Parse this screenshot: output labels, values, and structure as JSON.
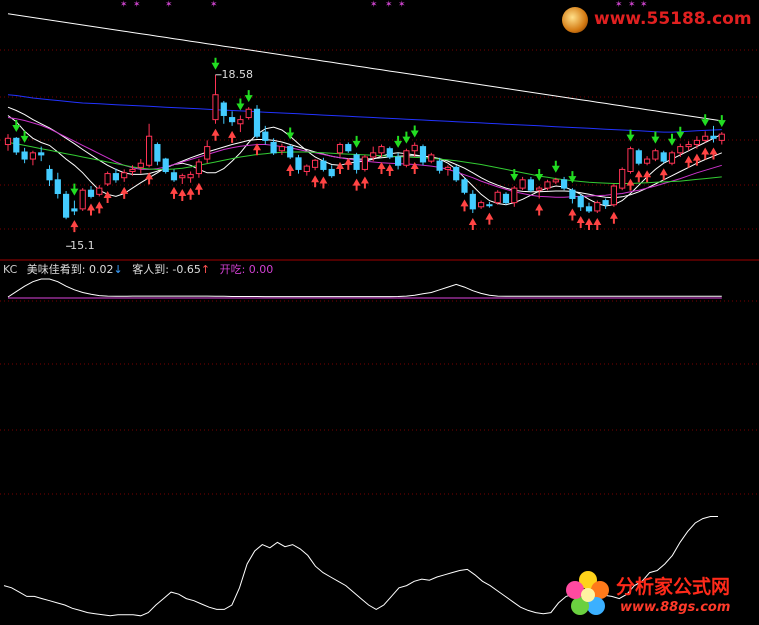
{
  "chart_data": {
    "type": "candlestick",
    "title": "",
    "candles": [
      [
        16.9,
        17.15,
        16.75,
        17.05
      ],
      [
        17.05,
        17.08,
        16.65,
        16.72
      ],
      [
        16.72,
        16.82,
        16.45,
        16.55
      ],
      [
        16.55,
        16.75,
        16.4,
        16.7
      ],
      [
        16.7,
        16.85,
        16.5,
        16.65
      ],
      [
        16.3,
        16.4,
        15.9,
        16.05
      ],
      [
        16.05,
        16.22,
        15.6,
        15.72
      ],
      [
        15.7,
        15.78,
        15.1,
        15.15
      ],
      [
        15.35,
        15.55,
        15.2,
        15.3
      ],
      [
        15.35,
        15.85,
        15.3,
        15.8
      ],
      [
        15.8,
        15.9,
        15.6,
        15.65
      ],
      [
        15.7,
        15.92,
        15.65,
        15.85
      ],
      [
        15.95,
        16.25,
        15.9,
        16.2
      ],
      [
        16.2,
        16.32,
        15.98,
        16.05
      ],
      [
        16.1,
        16.3,
        16.0,
        16.22
      ],
      [
        16.25,
        16.4,
        16.15,
        16.3
      ],
      [
        16.35,
        16.55,
        16.2,
        16.45
      ],
      [
        16.4,
        17.4,
        16.35,
        17.1
      ],
      [
        16.9,
        16.95,
        16.4,
        16.5
      ],
      [
        16.55,
        16.58,
        16.2,
        16.25
      ],
      [
        16.22,
        16.3,
        16.0,
        16.05
      ],
      [
        16.1,
        16.2,
        15.95,
        16.15
      ],
      [
        16.1,
        16.25,
        15.98,
        16.18
      ],
      [
        16.2,
        16.55,
        16.1,
        16.48
      ],
      [
        16.55,
        17.0,
        16.45,
        16.85
      ],
      [
        17.5,
        18.58,
        17.4,
        18.1
      ],
      [
        17.9,
        17.95,
        17.4,
        17.6
      ],
      [
        17.55,
        17.7,
        17.35,
        17.45
      ],
      [
        17.4,
        17.6,
        17.2,
        17.5
      ],
      [
        17.55,
        17.8,
        17.5,
        17.75
      ],
      [
        17.75,
        17.85,
        17.05,
        17.1
      ],
      [
        17.2,
        17.35,
        16.9,
        17.0
      ],
      [
        16.95,
        17.05,
        16.65,
        16.7
      ],
      [
        16.75,
        16.92,
        16.65,
        16.85
      ],
      [
        16.85,
        16.9,
        16.55,
        16.6
      ],
      [
        16.58,
        16.65,
        16.2,
        16.3
      ],
      [
        16.25,
        16.42,
        16.15,
        16.38
      ],
      [
        16.35,
        16.55,
        16.28,
        16.52
      ],
      [
        16.5,
        16.58,
        16.25,
        16.3
      ],
      [
        16.3,
        16.4,
        16.1,
        16.15
      ],
      [
        16.7,
        16.95,
        16.6,
        16.9
      ],
      [
        16.9,
        16.95,
        16.7,
        16.75
      ],
      [
        16.65,
        16.7,
        16.2,
        16.3
      ],
      [
        16.3,
        16.65,
        16.25,
        16.6
      ],
      [
        16.6,
        16.85,
        16.5,
        16.7
      ],
      [
        16.7,
        16.9,
        16.6,
        16.85
      ],
      [
        16.8,
        16.85,
        16.55,
        16.6
      ],
      [
        16.6,
        16.7,
        16.3,
        16.4
      ],
      [
        16.4,
        16.8,
        16.35,
        16.75
      ],
      [
        16.75,
        16.95,
        16.6,
        16.88
      ],
      [
        16.85,
        16.9,
        16.4,
        16.48
      ],
      [
        16.5,
        16.7,
        16.45,
        16.65
      ],
      [
        16.5,
        16.58,
        16.2,
        16.28
      ],
      [
        16.3,
        16.4,
        16.15,
        16.35
      ],
      [
        16.35,
        16.4,
        16.0,
        16.05
      ],
      [
        16.05,
        16.1,
        15.7,
        15.75
      ],
      [
        15.7,
        15.8,
        15.25,
        15.35
      ],
      [
        15.4,
        15.55,
        15.35,
        15.5
      ],
      [
        15.45,
        15.52,
        15.38,
        15.44
      ],
      [
        15.5,
        15.8,
        15.45,
        15.75
      ],
      [
        15.7,
        15.75,
        15.45,
        15.5
      ],
      [
        15.5,
        15.9,
        15.4,
        15.85
      ],
      [
        15.85,
        16.12,
        15.8,
        16.05
      ],
      [
        16.05,
        16.12,
        15.75,
        15.8
      ],
      [
        15.8,
        15.9,
        15.6,
        15.85
      ],
      [
        15.85,
        16.05,
        15.8,
        16.0
      ],
      [
        16.0,
        16.1,
        15.95,
        16.05
      ],
      [
        16.05,
        16.12,
        15.8,
        15.85
      ],
      [
        15.8,
        15.85,
        15.48,
        15.6
      ],
      [
        15.65,
        15.7,
        15.3,
        15.4
      ],
      [
        15.4,
        15.5,
        15.25,
        15.3
      ],
      [
        15.3,
        15.55,
        15.25,
        15.5
      ],
      [
        15.55,
        15.6,
        15.35,
        15.45
      ],
      [
        15.45,
        15.95,
        15.4,
        15.9
      ],
      [
        15.85,
        16.35,
        15.8,
        16.3
      ],
      [
        16.25,
        16.85,
        16.2,
        16.8
      ],
      [
        16.75,
        16.8,
        16.4,
        16.45
      ],
      [
        16.45,
        16.62,
        16.4,
        16.55
      ],
      [
        16.55,
        16.8,
        16.5,
        16.75
      ],
      [
        16.7,
        16.75,
        16.45,
        16.5
      ],
      [
        16.45,
        16.75,
        16.4,
        16.7
      ],
      [
        16.7,
        16.92,
        16.6,
        16.85
      ],
      [
        16.85,
        16.98,
        16.75,
        16.9
      ],
      [
        16.9,
        17.1,
        16.8,
        17.0
      ],
      [
        17.0,
        17.22,
        16.95,
        17.1
      ],
      [
        17.1,
        17.35,
        16.95,
        17.05
      ],
      [
        17.0,
        17.2,
        16.9,
        17.15
      ]
    ],
    "price_labels": {
      "high": "18.58",
      "low": "15.1"
    },
    "ma_series": [
      {
        "values": [
          17.6,
          17.45,
          17.22,
          17.05,
          16.95,
          16.88,
          16.72,
          16.55,
          16.4,
          16.22,
          16.0,
          15.8,
          15.7,
          15.65,
          15.72,
          15.85,
          15.98,
          16.1,
          16.22,
          16.35,
          16.42,
          16.45,
          16.4,
          16.3,
          16.22,
          16.22,
          16.32,
          16.5,
          16.7,
          16.95,
          17.15,
          17.28,
          17.32,
          17.25,
          17.1,
          16.92,
          16.75,
          16.6,
          16.5,
          16.42,
          16.4,
          16.45,
          16.48,
          16.5,
          16.55,
          16.62,
          16.68,
          16.7,
          16.68,
          16.65,
          16.62,
          16.6,
          16.55,
          16.45,
          16.3,
          16.1,
          15.9,
          15.7,
          15.55,
          15.48,
          15.45,
          15.5,
          15.58,
          15.68,
          15.78,
          15.85,
          15.9,
          15.88,
          15.8,
          15.7,
          15.58,
          15.48,
          15.42,
          15.45,
          15.55,
          15.72,
          15.92,
          16.12,
          16.3,
          16.45,
          16.55,
          16.65,
          16.75,
          16.85,
          16.95,
          17.05,
          17.15
        ]
      },
      {
        "values": [
          17.8,
          17.72,
          17.62,
          17.5,
          17.4,
          17.3,
          17.18,
          17.05,
          16.92,
          16.78,
          16.65,
          16.52,
          16.4,
          16.3,
          16.22,
          16.18,
          16.18,
          16.2,
          16.26,
          16.34,
          16.42,
          16.5,
          16.58,
          16.65,
          16.72,
          16.78,
          16.84,
          16.9,
          16.95,
          17.0,
          17.02,
          17.02,
          17.0,
          16.96,
          16.9,
          16.84,
          16.78,
          16.72,
          16.67,
          16.62,
          16.58,
          16.56,
          16.55,
          16.55,
          16.56,
          16.58,
          16.6,
          16.62,
          16.63,
          16.63,
          16.62,
          16.6,
          16.56,
          16.5,
          16.42,
          16.33,
          16.22,
          16.1,
          16.0,
          15.92,
          15.85,
          15.8,
          15.77,
          15.76,
          15.76,
          15.77,
          15.78,
          15.78,
          15.77,
          15.74,
          15.7,
          15.66,
          15.63,
          15.62,
          15.64,
          15.69,
          15.76,
          15.85,
          15.95,
          16.05,
          16.15,
          16.25,
          16.35,
          16.45,
          16.54,
          16.62,
          16.7
        ]
      },
      {
        "values": [
          17.55,
          17.52,
          17.48,
          17.42,
          17.36,
          17.28,
          17.18,
          17.08,
          16.98,
          16.88,
          16.78,
          16.68,
          16.58,
          16.48,
          16.4,
          16.34,
          16.3,
          16.3,
          16.32,
          16.36,
          16.42,
          16.48,
          16.54,
          16.6,
          16.66,
          16.72,
          16.78,
          16.82,
          16.86,
          16.88,
          16.9,
          16.9,
          16.88,
          16.85,
          16.82,
          16.78,
          16.74,
          16.7,
          16.66,
          16.62,
          16.58,
          16.55,
          16.52,
          16.5,
          16.48,
          16.46,
          16.45,
          16.44,
          16.43,
          16.42,
          16.4,
          16.38,
          16.35,
          16.3,
          16.24,
          16.17,
          16.1,
          16.02,
          15.95,
          15.88,
          15.82,
          15.76,
          15.72,
          15.68,
          15.65,
          15.64,
          15.63,
          15.63,
          15.64,
          15.65,
          15.66,
          15.67,
          15.68,
          15.7,
          15.72,
          15.76,
          15.8,
          15.85,
          15.9,
          15.96,
          16.02,
          16.08,
          16.15,
          16.22,
          16.28,
          16.34,
          16.4
        ]
      },
      {
        "values": [
          16.95,
          16.92,
          16.88,
          16.84,
          16.8,
          16.76,
          16.72,
          16.68,
          16.64,
          16.6,
          16.56,
          16.52,
          16.48,
          16.44,
          16.4,
          16.36,
          16.33,
          16.31,
          16.3,
          16.3,
          16.31,
          16.33,
          16.36,
          16.4,
          16.44,
          16.48,
          16.52,
          16.56,
          16.6,
          16.63,
          16.66,
          16.68,
          16.7,
          16.71,
          16.72,
          16.72,
          16.72,
          16.71,
          16.7,
          16.69,
          16.68,
          16.67,
          16.66,
          16.65,
          16.64,
          16.63,
          16.62,
          16.61,
          16.6,
          16.59,
          16.58,
          16.57,
          16.55,
          16.53,
          16.51,
          16.48,
          16.45,
          16.42,
          16.38,
          16.34,
          16.3,
          16.26,
          16.22,
          16.18,
          16.14,
          16.11,
          16.08,
          16.05,
          16.03,
          16.01,
          15.99,
          15.98,
          15.97,
          15.96,
          15.96,
          15.96,
          15.97,
          15.98,
          15.99,
          16.0,
          16.01,
          16.02,
          16.04,
          16.06,
          16.08,
          16.1,
          16.12
        ]
      },
      {
        "values": [
          18.1,
          18.08,
          18.05,
          18.02,
          18.0,
          17.98,
          17.96,
          17.94,
          17.92,
          17.9,
          17.89,
          17.88,
          17.87,
          17.86,
          17.85,
          17.84,
          17.83,
          17.82,
          17.81,
          17.8,
          17.79,
          17.78,
          17.77,
          17.76,
          17.75,
          17.74,
          17.73,
          17.72,
          17.71,
          17.7,
          17.69,
          17.68,
          17.67,
          17.66,
          17.65,
          17.64,
          17.63,
          17.62,
          17.61,
          17.6,
          17.59,
          17.58,
          17.57,
          17.56,
          17.55,
          17.54,
          17.53,
          17.52,
          17.51,
          17.5,
          17.49,
          17.48,
          17.47,
          17.46,
          17.45,
          17.44,
          17.43,
          17.42,
          17.41,
          17.4,
          17.39,
          17.38,
          17.37,
          17.36,
          17.35,
          17.34,
          17.33,
          17.32,
          17.31,
          17.3,
          17.29,
          17.28,
          17.27,
          17.26,
          17.25,
          17.24,
          17.23,
          17.22,
          17.21,
          17.2,
          17.2,
          17.21,
          17.22,
          17.23,
          17.24,
          17.25,
          17.26
        ]
      },
      {
        "values": [
          20.05,
          20.02,
          19.99,
          19.96,
          19.93,
          19.9,
          19.87,
          19.84,
          19.81,
          19.78,
          19.75,
          19.72,
          19.69,
          19.66,
          19.63,
          19.6,
          19.57,
          19.54,
          19.51,
          19.48,
          19.45,
          19.42,
          19.39,
          19.36,
          19.33,
          19.3,
          19.27,
          19.24,
          19.21,
          19.18,
          19.15,
          19.12,
          19.09,
          19.06,
          19.03,
          19.0,
          18.97,
          18.94,
          18.91,
          18.88,
          18.85,
          18.82,
          18.79,
          18.76,
          18.73,
          18.7,
          18.67,
          18.64,
          18.61,
          18.58,
          18.55,
          18.52,
          18.49,
          18.46,
          18.43,
          18.4,
          18.37,
          18.34,
          18.31,
          18.28,
          18.25,
          18.22,
          18.19,
          18.16,
          18.13,
          18.1,
          18.07,
          18.04,
          18.01,
          17.98,
          17.95,
          17.92,
          17.89,
          17.86,
          17.83,
          17.8,
          17.77,
          17.74,
          17.71,
          17.68,
          17.65,
          17.62,
          17.59,
          17.56,
          17.53,
          17.5,
          17.47
        ]
      }
    ],
    "down_arrows": [
      1,
      2,
      8,
      25,
      28,
      29,
      34,
      42,
      47,
      48,
      49,
      61,
      64,
      66,
      68,
      75,
      78,
      80,
      81,
      84,
      86
    ],
    "up_arrows": [
      8,
      10,
      11,
      12,
      14,
      17,
      20,
      21,
      22,
      23,
      25,
      27,
      30,
      34,
      37,
      38,
      40,
      41,
      42,
      43,
      45,
      46,
      49,
      55,
      56,
      58,
      64,
      68,
      69,
      70,
      71,
      73,
      75,
      76,
      77,
      79,
      82,
      83,
      84,
      85
    ],
    "indicator_labels": {
      "prefix": "KC",
      "series": [
        {
          "text": "美味佳肴到: 0.02",
          "arrow": "↓"
        },
        {
          "text": "客人到: -0.65",
          "arrow": "↑"
        },
        {
          "text": "开吃: 0.00",
          "arrow": ""
        }
      ]
    },
    "indicator_values": [
      0.0,
      0.3,
      0.6,
      0.85,
      1.0,
      1.0,
      0.85,
      0.6,
      0.4,
      0.25,
      0.15,
      0.08,
      0.05,
      0.04,
      0.04,
      0.05,
      0.05,
      0.05,
      0.05,
      0.05,
      0.05,
      0.05,
      0.05,
      0.05,
      0.05,
      0.04,
      0.04,
      0.03,
      0.03,
      0.03,
      0.03,
      0.02,
      0.02,
      0.02,
      0.02,
      0.02,
      0.02,
      0.02,
      0.02,
      0.02,
      0.02,
      0.02,
      0.02,
      0.02,
      0.02,
      0.02,
      0.02,
      0.03,
      0.05,
      0.1,
      0.18,
      0.25,
      0.4,
      0.55,
      0.7,
      0.55,
      0.35,
      0.2,
      0.1,
      0.05,
      0.04,
      0.04,
      0.04,
      0.04,
      0.04,
      0.04,
      0.04,
      0.04,
      0.04,
      0.04,
      0.04,
      0.04,
      0.04,
      0.04,
      0.04,
      0.04,
      0.04,
      0.04,
      0.04,
      0.04,
      0.04,
      0.04,
      0.04,
      0.04,
      0.04,
      0.04,
      0.04
    ],
    "oscillator_values": [
      0.3,
      0.28,
      0.24,
      0.2,
      0.2,
      0.18,
      0.16,
      0.14,
      0.12,
      0.09,
      0.07,
      0.05,
      0.04,
      0.03,
      0.02,
      0.03,
      0.03,
      0.03,
      0.02,
      0.05,
      0.12,
      0.18,
      0.24,
      0.22,
      0.18,
      0.16,
      0.13,
      0.1,
      0.08,
      0.08,
      0.12,
      0.28,
      0.5,
      0.62,
      0.68,
      0.65,
      0.7,
      0.66,
      0.68,
      0.64,
      0.58,
      0.48,
      0.42,
      0.38,
      0.34,
      0.3,
      0.24,
      0.18,
      0.12,
      0.08,
      0.12,
      0.2,
      0.28,
      0.3,
      0.34,
      0.36,
      0.35,
      0.38,
      0.4,
      0.42,
      0.44,
      0.45,
      0.4,
      0.34,
      0.3,
      0.25,
      0.2,
      0.15,
      0.1,
      0.07,
      0.05,
      0.04,
      0.05,
      0.14,
      0.2,
      0.22,
      0.23,
      0.21,
      0.2,
      0.21,
      0.2,
      0.18,
      0.22,
      0.3,
      0.34,
      0.42,
      0.44,
      0.5,
      0.58,
      0.7,
      0.8,
      0.88,
      0.92,
      0.94,
      0.94
    ]
  },
  "logos": {
    "top_url": "www.55188.com",
    "bottom_name": "分析家公式网",
    "bottom_url": "www.88gs.com"
  }
}
